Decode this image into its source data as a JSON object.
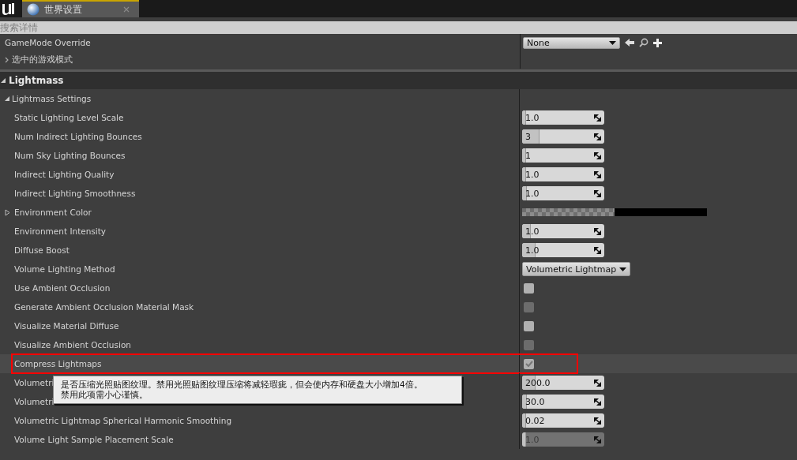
{
  "tab": {
    "title": "世界设置",
    "selected": true
  },
  "search": {
    "placeholder": "搜索详情"
  },
  "top_rows": [
    {
      "label": "GameMode Override",
      "kind": "dropdown",
      "value": "None"
    },
    {
      "label": "选中的游戏模式",
      "kind": "group",
      "expanded": false
    }
  ],
  "category": {
    "label": "Lightmass",
    "expanded": true
  },
  "section": {
    "label": "Lightmass Settings",
    "expanded": true
  },
  "rows": [
    {
      "label": "Static Lighting Level Scale",
      "kind": "number",
      "value": "1.0",
      "level": 0.0,
      "disabled": false
    },
    {
      "label": "Num Indirect Lighting Bounces",
      "kind": "number",
      "value": "3",
      "level": 0.2,
      "disabled": false
    },
    {
      "label": "Num Sky Lighting Bounces",
      "kind": "number",
      "value": "1",
      "level": 0.0,
      "disabled": false
    },
    {
      "label": "Indirect Lighting Quality",
      "kind": "number",
      "value": "1.0",
      "level": 0.0,
      "disabled": false
    },
    {
      "label": "Indirect Lighting Smoothness",
      "kind": "number",
      "value": "1.0",
      "level": 0.05,
      "disabled": false
    },
    {
      "label": "Environment Color",
      "kind": "color",
      "expanded": false
    },
    {
      "label": "Environment Intensity",
      "kind": "number",
      "value": "1.0",
      "level": 0.1,
      "disabled": false
    },
    {
      "label": "Diffuse Boost",
      "kind": "number",
      "value": "1.0",
      "level": 0.15,
      "disabled": false
    },
    {
      "label": "Volume Lighting Method",
      "kind": "dropdown",
      "value": "Volumetric Lightmap"
    },
    {
      "label": "Use Ambient Occlusion",
      "kind": "checkbox",
      "checked": false,
      "disabled": false
    },
    {
      "label": "Generate Ambient Occlusion Material Mask",
      "kind": "checkbox",
      "checked": false,
      "disabled": true
    },
    {
      "label": "Visualize Material Diffuse",
      "kind": "checkbox",
      "checked": false,
      "disabled": false
    },
    {
      "label": "Visualize Ambient Occlusion",
      "kind": "checkbox",
      "checked": false,
      "disabled": true
    },
    {
      "label": "Compress Lightmaps",
      "kind": "checkbox",
      "checked": true,
      "disabled": false,
      "highlighted": true
    },
    {
      "label": "Volumetri",
      "kind": "number",
      "value": "200.0",
      "level": 0.15,
      "disabled": false
    },
    {
      "label": "Volumetri",
      "kind": "number",
      "value": "30.0",
      "level": 0.05,
      "disabled": false
    },
    {
      "label": "Volumetric Lightmap Spherical Harmonic Smoothing",
      "kind": "number",
      "value": "0.02",
      "level": 0.02,
      "disabled": false
    },
    {
      "label": "Volume Light Sample Placement Scale",
      "kind": "number",
      "value": "1.0",
      "level": 0.0,
      "disabled": true
    }
  ],
  "tooltip": {
    "lines": [
      "是否压缩光照贴图纹理。禁用光照贴图纹理压缩将减轻瑕疵，但会使内存和硬盘大小增加4倍。",
      "禁用此项需小心谨慎。"
    ]
  }
}
